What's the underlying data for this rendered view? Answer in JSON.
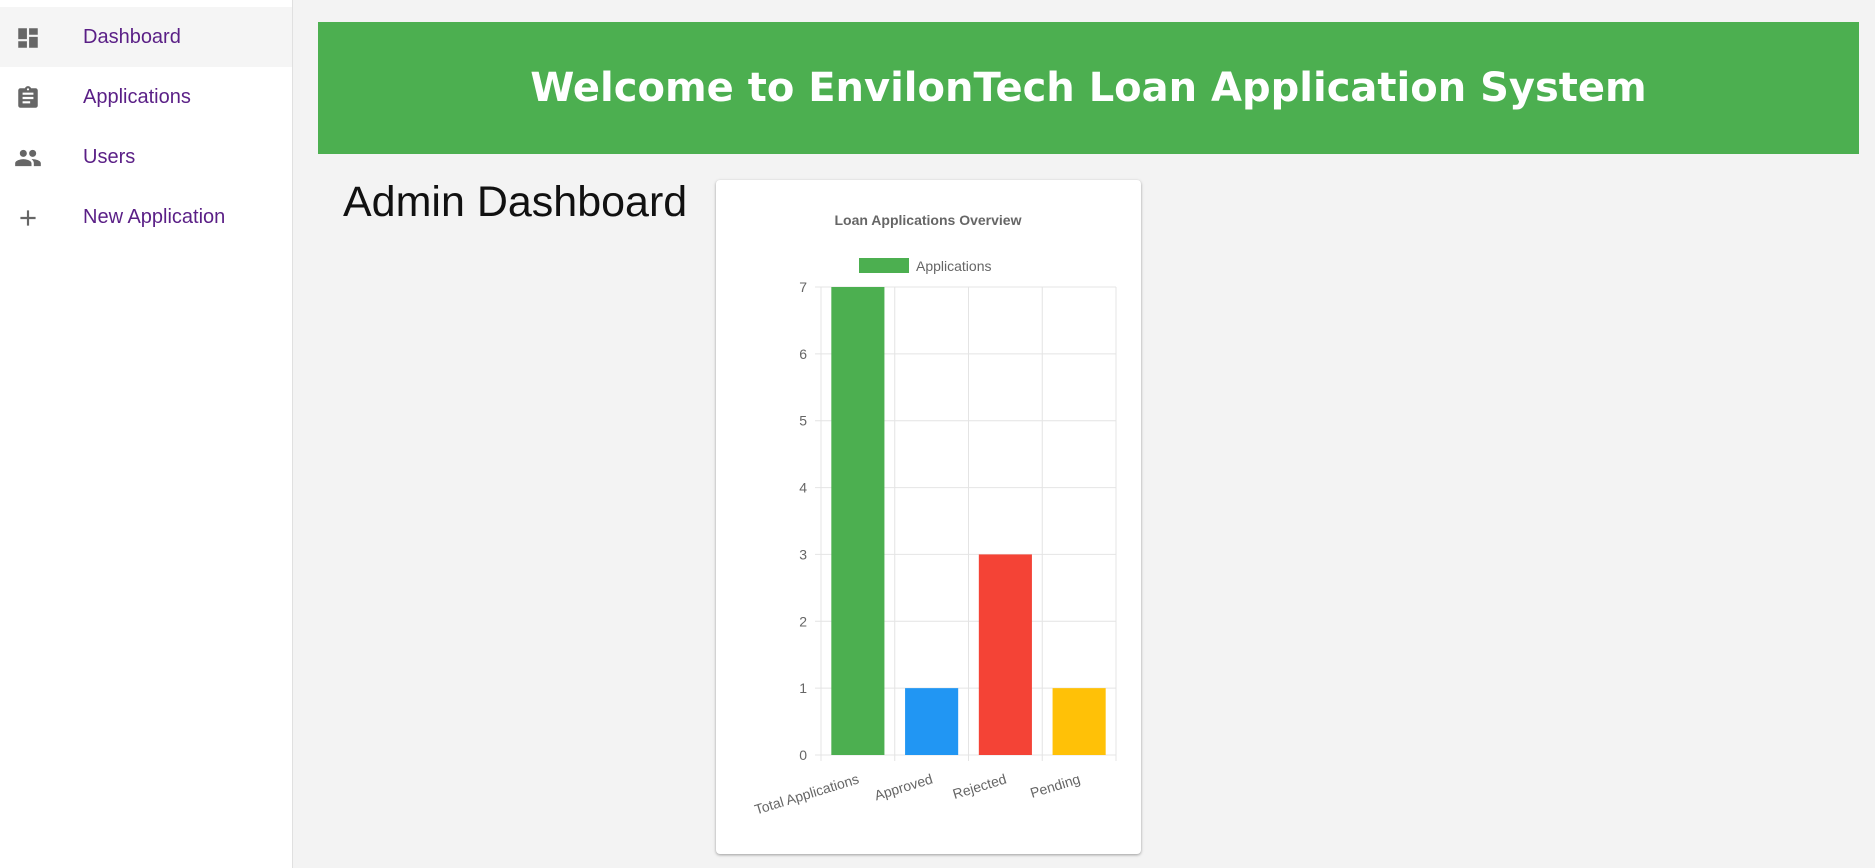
{
  "sidebar": {
    "items": [
      {
        "label": "Dashboard",
        "icon": "dashboard-icon",
        "active": true
      },
      {
        "label": "Applications",
        "icon": "clipboard-icon",
        "active": false
      },
      {
        "label": "Users",
        "icon": "people-icon",
        "active": false
      },
      {
        "label": "New Application",
        "icon": "plus-icon",
        "active": false
      }
    ],
    "label_color": "#5a1f86"
  },
  "banner": {
    "title": "Welcome to EnvilonTech Loan Application System",
    "background": "#4caf50"
  },
  "main": {
    "page_title": "Admin Dashboard"
  },
  "chart_data": {
    "type": "bar",
    "title": "Loan Applications Overview",
    "categories": [
      "Total Applications",
      "Approved",
      "Rejected",
      "Pending"
    ],
    "series": [
      {
        "name": "Applications",
        "values": [
          7,
          1,
          3,
          1
        ]
      }
    ],
    "bar_colors": [
      "#4caf50",
      "#2196f3",
      "#f44336",
      "#ffc107"
    ],
    "legend_color": "#4caf50",
    "ylim": [
      0,
      7
    ],
    "yticks": [
      "0",
      "1",
      "2",
      "3",
      "4",
      "5",
      "6",
      "7"
    ],
    "grid": true,
    "legend": "top"
  }
}
